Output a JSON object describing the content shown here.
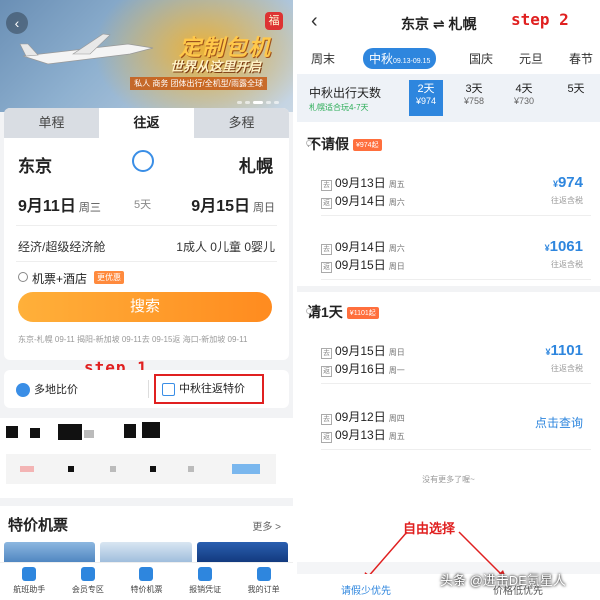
{
  "left": {
    "banner": {
      "title": "定制包机",
      "subtitle": "世界从这里开启",
      "tags": "私人 商务 团体出行/全机型/雨露全球",
      "badge": "福"
    },
    "trip_tabs": [
      "单程",
      "往返",
      "多程"
    ],
    "from_city": "东京",
    "to_city": "札幌",
    "depart_date": "9月11日",
    "depart_weekday": "周三",
    "duration": "5天",
    "return_date": "9月15日",
    "return_weekday": "周日",
    "cabin": "经济/超级经济舱",
    "passengers": "1成人 0儿童 0婴儿",
    "hotel_option": "机票+酒店",
    "hotel_tag": "更优惠",
    "search_label": "搜索",
    "history": "东京-札幌 09-11    揭阳-新加坡 09-11去 09-15返    海口-新加坡 09-11",
    "quick_multi": "多地比价",
    "quick_festival": "中秋往返特价",
    "step1": "step 1",
    "section_title": "特价机票",
    "section_more": "更多 >",
    "bottom_nav": [
      "航班助手",
      "会员专区",
      "特价机票",
      "报销凭证",
      "我的订单"
    ]
  },
  "right": {
    "route_title": "东京 ⇌ 札幌",
    "step2": "step 2",
    "holiday_tabs": [
      "周末",
      "中秋",
      "09.13-09.15",
      "国庆",
      "元旦",
      "春节"
    ],
    "days_label": "中秋出行天数",
    "days_sub": "札幌适合玩4-7天",
    "day_options": [
      {
        "days": "2天",
        "price": "¥974"
      },
      {
        "days": "3天",
        "price": "¥758"
      },
      {
        "days": "4天",
        "price": "¥730"
      },
      {
        "days": "5天",
        "price": ""
      }
    ],
    "groups": [
      {
        "title": "不请假",
        "pill": "¥974起"
      },
      {
        "title": "请1天",
        "pill": "¥1101起"
      }
    ],
    "items": [
      {
        "go": "09月13日",
        "go_wk": "周五",
        "back": "09月14日",
        "back_wk": "周六",
        "price": "974",
        "note": "往返含税"
      },
      {
        "go": "09月14日",
        "go_wk": "周六",
        "back": "09月15日",
        "back_wk": "周日",
        "price": "1061",
        "note": "往返含税"
      },
      {
        "go": "09月15日",
        "go_wk": "周日",
        "back": "09月16日",
        "back_wk": "周一",
        "price": "1101",
        "note": "往返含税"
      },
      {
        "go": "09月12日",
        "go_wk": "周四",
        "back": "09月13日",
        "back_wk": "周五",
        "query": "点击查询"
      }
    ],
    "go_tag": "去",
    "back_tag": "返",
    "currency": "¥",
    "no_more": "没有更多了喔~",
    "free_choice": "自由选择",
    "sort_leave": "请假少优先",
    "sort_price": "价格低优先"
  },
  "watermark": "头条 @进击DE氪星人"
}
